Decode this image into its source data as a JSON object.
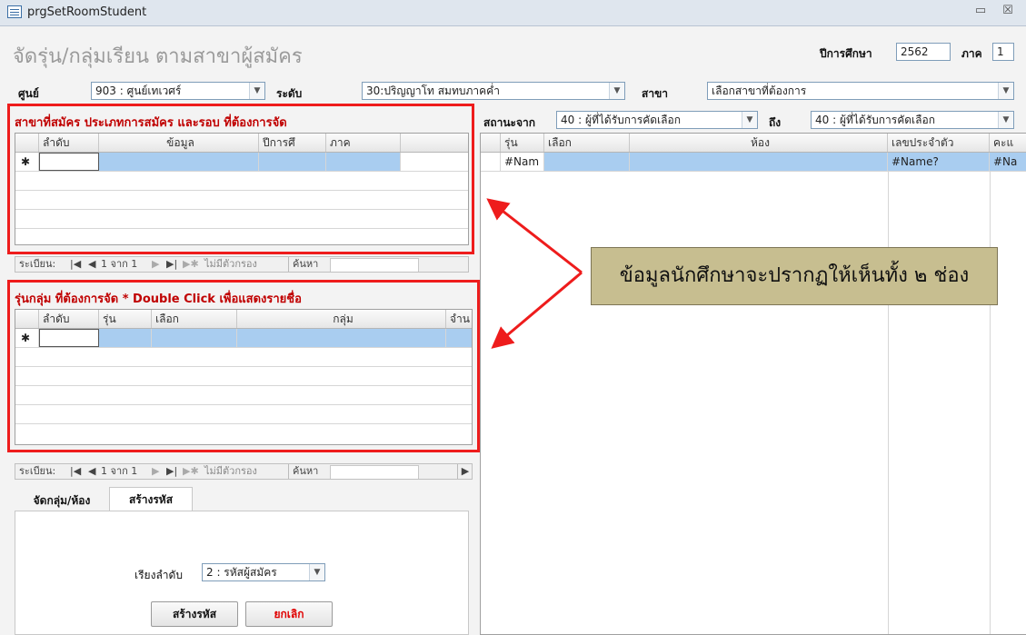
{
  "window": {
    "title": "prgSetRoomStudent",
    "minimize_glyph": "▭",
    "close_glyph": "☒"
  },
  "header": {
    "form_title": "จัดรุ่น/กลุ่มเรียน ตามสาขาผู้สมัคร",
    "academic_year_label": "ปีการศึกษา",
    "academic_year_value": "2562",
    "term_label": "ภาค",
    "term_value": "1",
    "center_label": "ศูนย์",
    "center_value": "903 : ศูนย์เทเวศร์",
    "level_label": "ระดับ",
    "level_value": "30:ปริญญาโท สมทบภาคค่ำ",
    "major_label": "สาขา",
    "major_value": "เลือกสาขาที่ต้องการ"
  },
  "section1": {
    "title": "สาขาที่สมัคร ประเภทการสมัคร และรอบ ที่ต้องการจัด",
    "columns": [
      "ลำดับ",
      "ข้อมูล",
      "ปีการศึ",
      "ภาค"
    ],
    "new_row_marker": "✱"
  },
  "nav1": {
    "record_label": "ระเบียน:",
    "position": "1 จาก 1",
    "filter_label": "ไม่มีตัวกรอง",
    "search_label": "ค้นหา"
  },
  "section2": {
    "title": "รุ่นกลุ่ม ที่ต้องการจัด * Double Click เพื่อแสดงรายชื่อ",
    "columns": [
      "ลำดับ",
      "รุ่น",
      "เลือก",
      "กลุ่ม",
      "จำน"
    ],
    "new_row_marker": "✱"
  },
  "nav2": {
    "record_label": "ระเบียน:",
    "position": "1 จาก 1",
    "filter_label": "ไม่มีตัวกรอง",
    "search_label": "ค้นหา"
  },
  "tabs": {
    "tab1": "จัดกลุ่ม/ห้อง",
    "tab2": "สร้างรหัส",
    "sort_label": "เรียงลำดับ",
    "sort_value": "2 : รหัสผู้สมัคร",
    "create_button": "สร้างรหัส",
    "cancel_button": "ยกเลิก"
  },
  "right": {
    "status_from_label": "สถานะจาก",
    "status_from_value": "40 : ผู้ที่ได้รับการคัดเลือก",
    "to_label": "ถึง",
    "status_to_value": "40 : ผู้ที่ได้รับการคัดเลือก",
    "columns": [
      "รุ่น",
      "เลือก",
      "ห้อง",
      "เลขประจำตัว",
      "คะแ"
    ],
    "row": [
      "#Nam",
      "",
      "",
      "#Name?",
      "#Na"
    ]
  },
  "callout": {
    "text": "ข้อมูลนักศึกษาจะปรากฏให้เห็นทั้ง ๒ ช่อง"
  },
  "colors": {
    "highlight_box": "#ee1c1c",
    "selected_row": "#a9cdf0",
    "callout_bg": "#c7be90"
  }
}
